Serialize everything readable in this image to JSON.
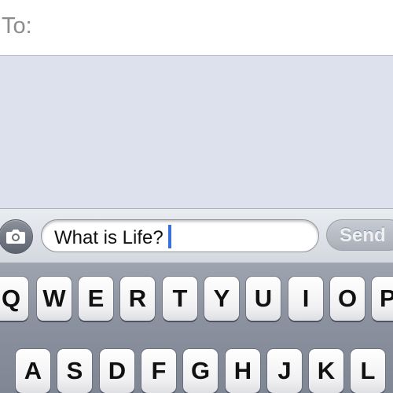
{
  "to_field": {
    "label": "To:"
  },
  "compose": {
    "text_value": "What is Life?",
    "send_label": "Send",
    "camera_icon": "camera-icon"
  },
  "keyboard": {
    "row1": [
      "Q",
      "W",
      "E",
      "R",
      "T",
      "Y",
      "U",
      "I",
      "O",
      "P"
    ],
    "row2": [
      "A",
      "S",
      "D",
      "F",
      "G",
      "H",
      "J",
      "K",
      "L"
    ]
  },
  "colors": {
    "background": "#dce1ed",
    "cursor": "#3a6fdc",
    "keyboard": "#8c929f"
  }
}
